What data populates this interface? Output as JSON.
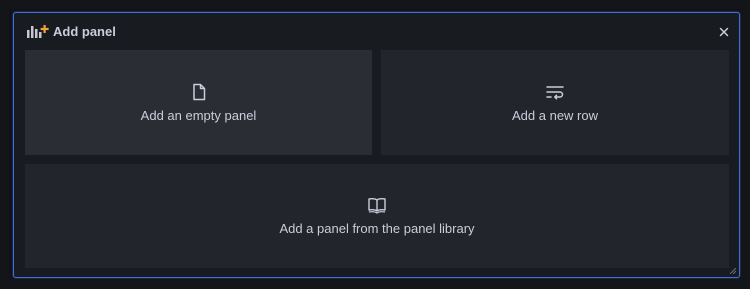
{
  "header": {
    "title": "Add panel",
    "icon": "add-panel-icon"
  },
  "options": {
    "empty_panel": {
      "label": "Add an empty panel",
      "icon": "file-icon"
    },
    "new_row": {
      "label": "Add a new row",
      "icon": "row-wrap-icon"
    },
    "library": {
      "label": "Add a panel from the panel library",
      "icon": "book-open-icon"
    }
  },
  "colors": {
    "accent_border": "#3d71d9",
    "panel_bg": "#181b1f",
    "card_bg": "#22252b",
    "card_hover_bg": "#2a2d33",
    "text": "#ccccdc",
    "brand_orange": "#f5a03c"
  }
}
